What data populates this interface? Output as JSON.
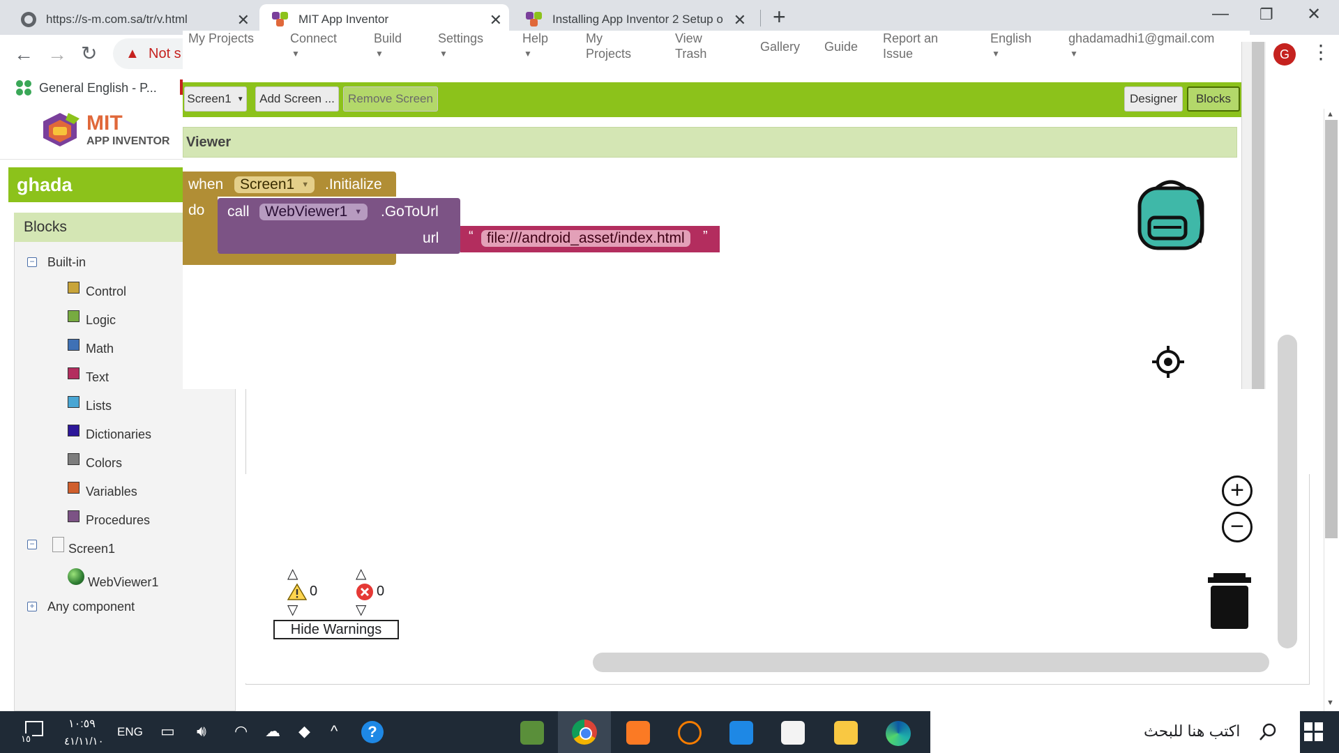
{
  "browser": {
    "tabs": [
      {
        "title": "https://s-m.com.sa/tr/v.html"
      },
      {
        "title": "MIT App Inventor"
      },
      {
        "title": "Installing App Inventor 2 Setup o"
      }
    ],
    "new_tab_label": "+",
    "address_warning": "Not s",
    "bookmark": "General English - P...",
    "profile_initial": "G"
  },
  "app": {
    "logo_line1": "MIT",
    "logo_line2": "APP INVENTOR",
    "nav": {
      "my_projects_top": "My Projects",
      "connect": "Connect",
      "build": "Build",
      "settings": "Settings",
      "help": "Help",
      "my_projects": "My\nProjects",
      "view_trash": "View\nTrash",
      "gallery": "Gallery",
      "guide": "Guide",
      "report_issue": "Report an\nIssue",
      "language": "English",
      "account": "ghadamadhi1@gmail.com"
    },
    "screen_bar": {
      "screen_select": "Screen1",
      "add_screen": "Add Screen ...",
      "remove_screen": "Remove Screen",
      "designer": "Designer",
      "blocks": "Blocks"
    },
    "project_name": "ghada",
    "blocks_panel": {
      "title": "Blocks",
      "builtin": "Built-in",
      "categories": [
        {
          "label": "Control",
          "color": "#c8a43a"
        },
        {
          "label": "Logic",
          "color": "#77ab41"
        },
        {
          "label": "Math",
          "color": "#3f71b5"
        },
        {
          "label": "Text",
          "color": "#b32d5e"
        },
        {
          "label": "Lists",
          "color": "#49a6d4"
        },
        {
          "label": "Dictionaries",
          "color": "#2d1799"
        },
        {
          "label": "Colors",
          "color": "#7d7d7d"
        },
        {
          "label": "Variables",
          "color": "#d05f2d"
        },
        {
          "label": "Procedures",
          "color": "#7c5385"
        }
      ],
      "screen": "Screen1",
      "component": "WebViewer1",
      "any_component": "Any component"
    },
    "viewer": {
      "title": "Viewer",
      "event_when": "when",
      "event_component": "Screen1",
      "event_name": ".Initialize",
      "do_label": "do",
      "call_label": "call",
      "method_component": "WebViewer1",
      "method_name": ".GoToUrl",
      "url_label": "url",
      "quote_open": "“",
      "text_value": "file:///android_asset/index.html",
      "quote_close": "”",
      "warnings_count": "0",
      "errors_count": "0",
      "hide_warnings": "Hide Warnings"
    }
  },
  "taskbar": {
    "time": "١٠:٥٩",
    "date": "٤١/١١/١٠",
    "lang": "ENG",
    "notif_count": "١٥",
    "search_placeholder": "اكتب هنا للبحث"
  }
}
